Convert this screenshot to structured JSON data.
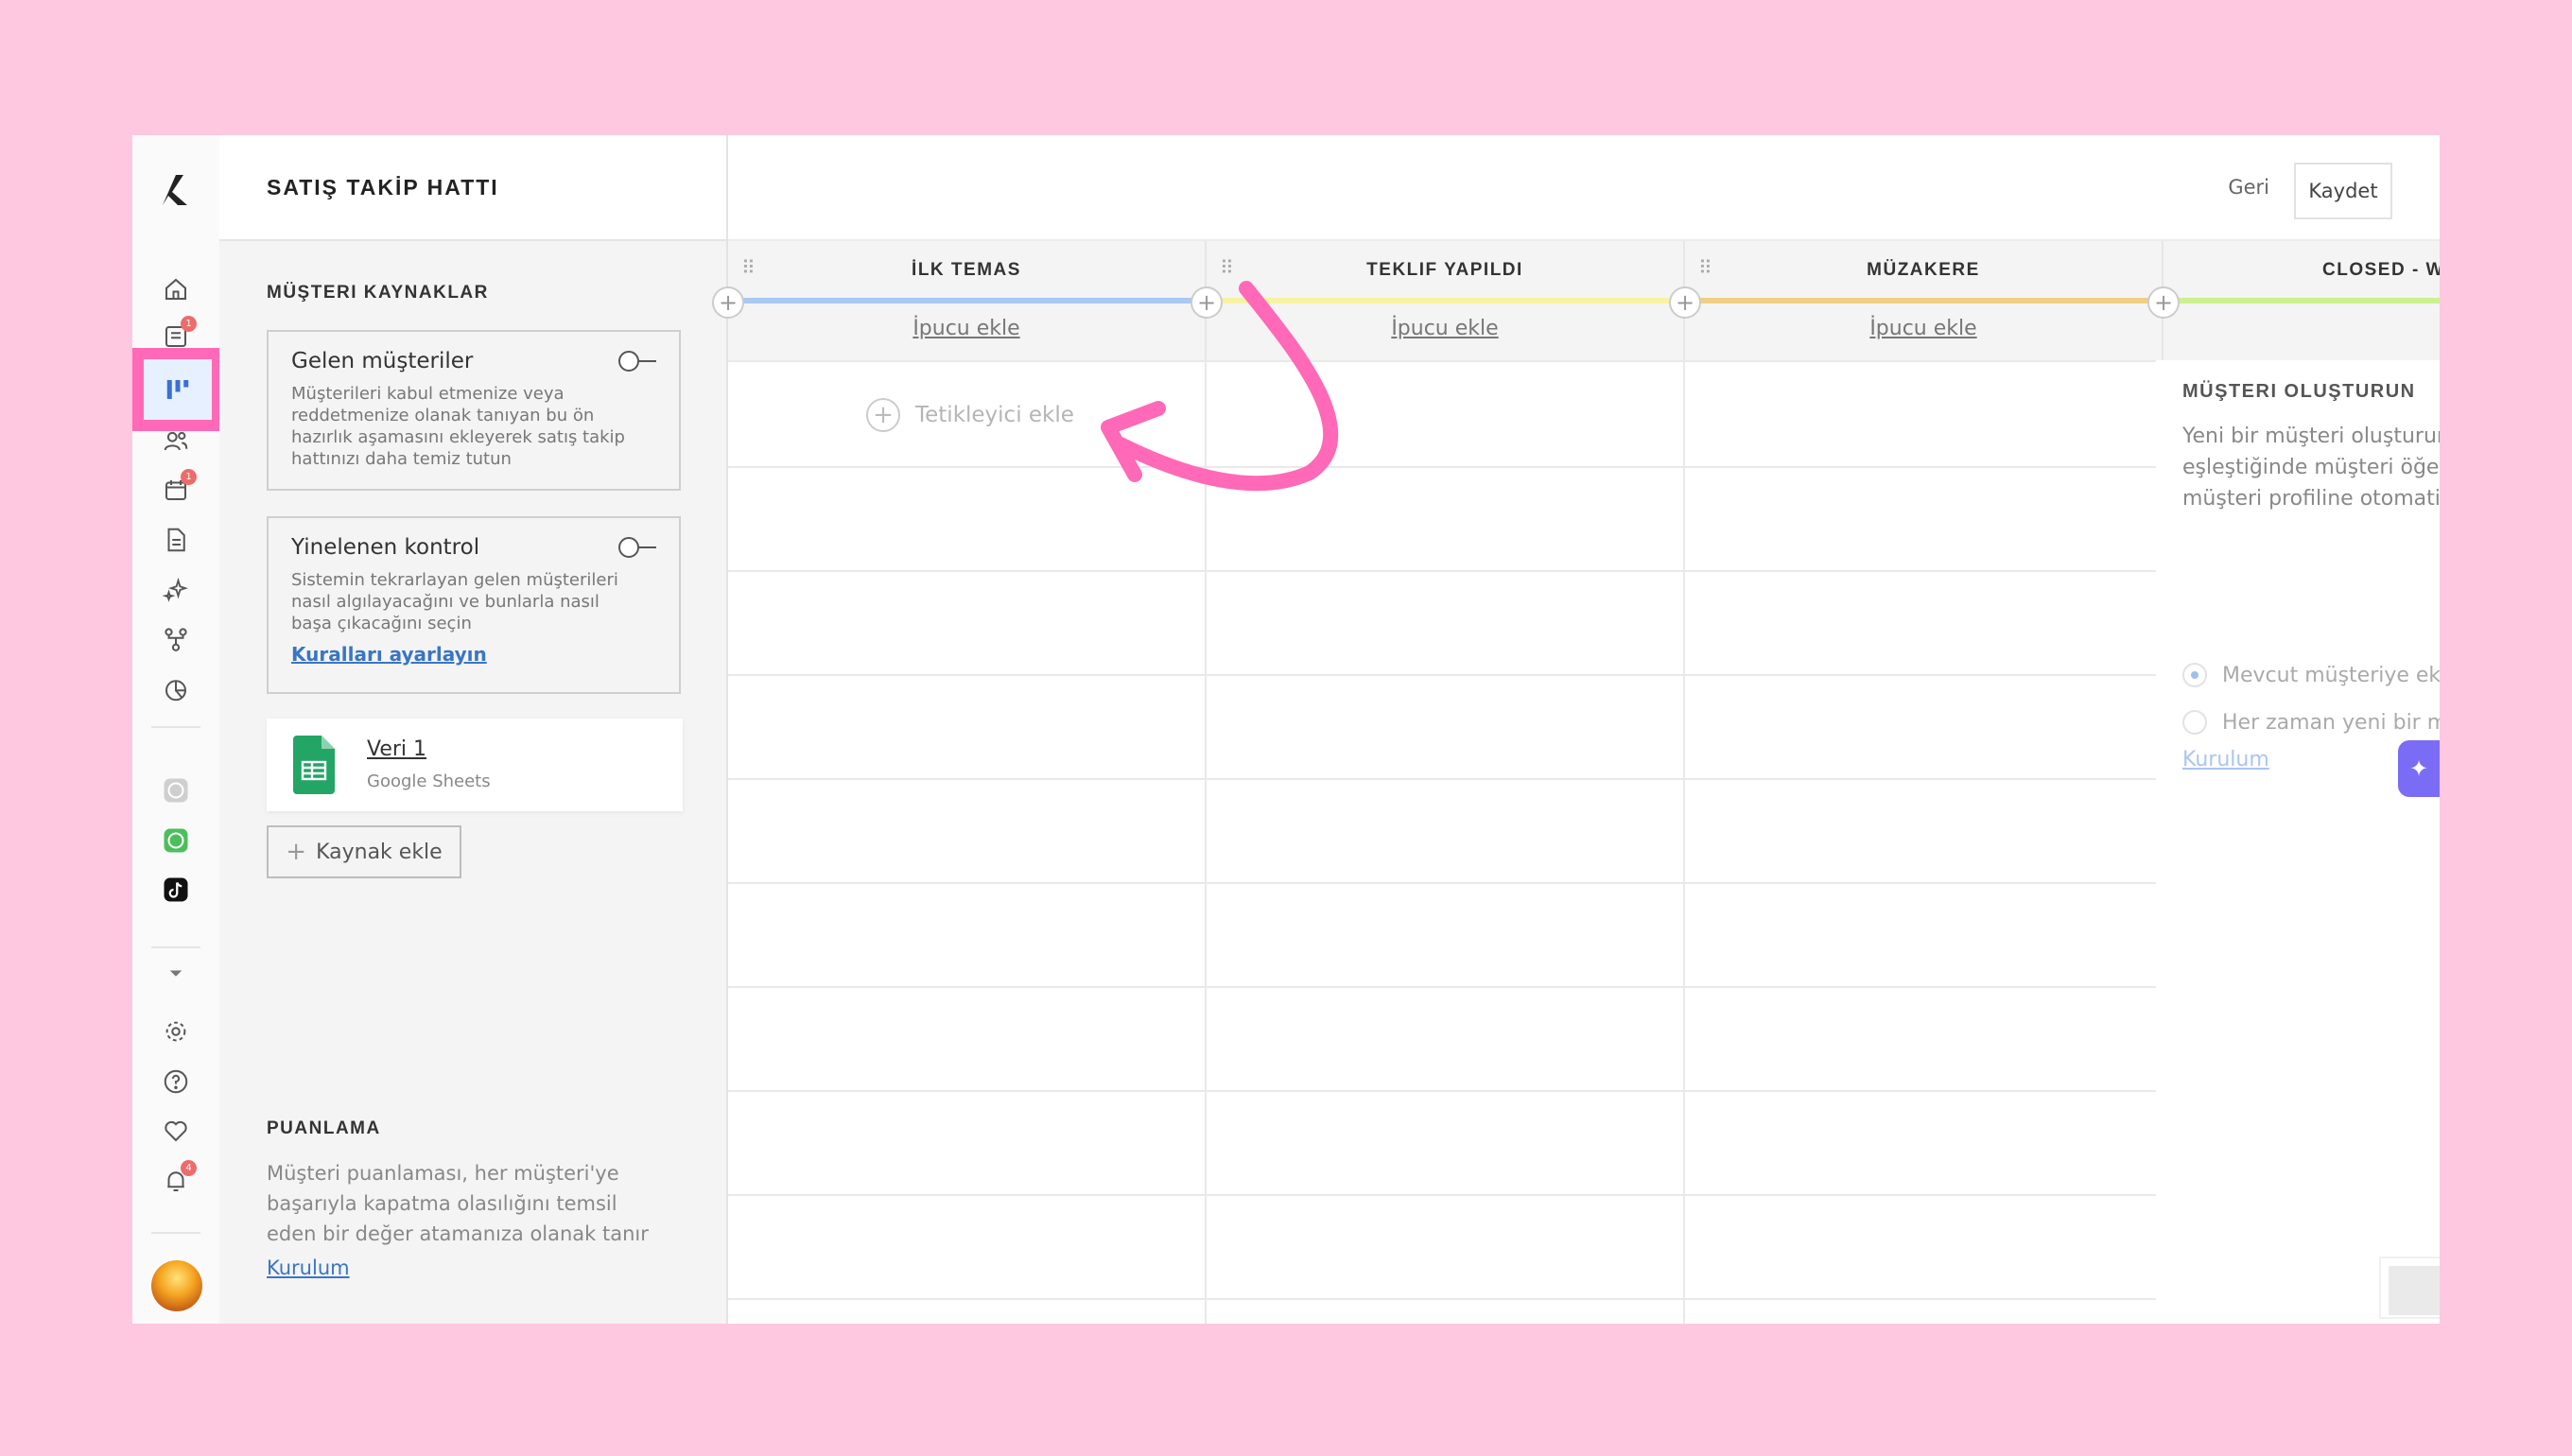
{
  "app": {
    "title": "SATIŞ TAKİP HATTI"
  },
  "rail": {
    "badges": {
      "inbox": "1",
      "calendar": "1",
      "notifications": "4"
    }
  },
  "sources": {
    "title": "MÜŞTERI KAYNAKLAR",
    "incoming": {
      "title": "Gelen müşteriler",
      "description": "Müşterileri kabul etmenize veya reddetmenize olanak tanıyan bu ön hazırlık aşamasını ekleyerek satış takip hattınızı daha temiz tutun"
    },
    "duplicate": {
      "title": "Yinelenen kontrol",
      "description": "Sistemin tekrarlayan gelen müşterileri nasıl algılayacağını ve bunlarla nasıl başa çıkacağını seçin",
      "link": "Kuralları ayarlayın"
    },
    "source_item": {
      "name": "Veri 1",
      "type": "Google Sheets"
    },
    "add_label": "Kaynak ekle"
  },
  "scoring": {
    "title": "PUANLAMA",
    "description": "Müşteri puanlaması, her müşteri'ye başarıyla kapatma olasılığını temsil eden bir değer atamanıza olanak tanır",
    "link": "Kurulum"
  },
  "toolbar": {
    "back_label": "Geri",
    "save_label": "Kaydet"
  },
  "stages": [
    {
      "name": "İLK TEMAS",
      "hint": "İpucu ekle",
      "color": "#a9c8f2"
    },
    {
      "name": "TEKLIF YAPILDI",
      "hint": "İpucu ekle",
      "color": "#f7f3a0"
    },
    {
      "name": "MÜZAKERE",
      "hint": "İpucu ekle",
      "color": "#f0cf84"
    },
    {
      "name": "CLOSED - W",
      "color": "#cdf08f"
    }
  ],
  "trigger": {
    "label": "Tetikleyici ekle"
  },
  "closed_panel": {
    "title": "MÜŞTERI OLUŞTURUN",
    "description_lines": [
      "Yeni bir müşteri oluşturun",
      "eşleştiğinde müşteri öğes",
      "müşteri profiline otomati"
    ],
    "option_existing": "Mevcut müşteriye ekl",
    "option_new": "Her zaman yeni bir m",
    "link": "Kurulum"
  },
  "colors": {
    "accent": "#3a75c4",
    "highlight": "#ff69b7",
    "background": "#fec8e0"
  }
}
